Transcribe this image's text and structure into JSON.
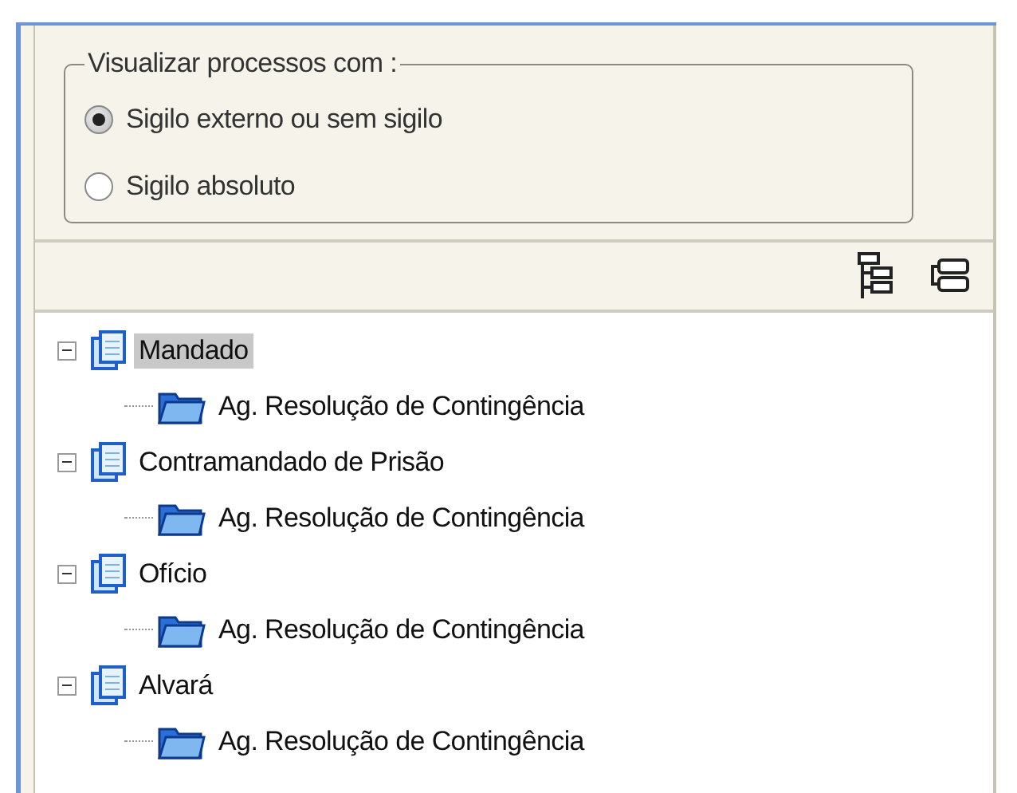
{
  "filter_group": {
    "title": "Visualizar processos com :",
    "options": [
      {
        "label": "Sigilo externo ou sem sigilo",
        "selected": true
      },
      {
        "label": "Sigilo absoluto",
        "selected": false
      }
    ]
  },
  "tree": {
    "items": [
      {
        "label": "Mandado",
        "kind": "document",
        "expanded": true,
        "selected": true,
        "children": [
          {
            "label": "Ag. Resolução de Contingência",
            "kind": "folder",
            "selected": false
          }
        ]
      },
      {
        "label": "Contramandado de Prisão",
        "kind": "document",
        "expanded": true,
        "selected": false,
        "children": [
          {
            "label": "Ag. Resolução de Contingência",
            "kind": "folder",
            "selected": false
          }
        ]
      },
      {
        "label": "Ofício",
        "kind": "document",
        "expanded": true,
        "selected": false,
        "children": [
          {
            "label": "Ag. Resolução de Contingência",
            "kind": "folder",
            "selected": false
          }
        ]
      },
      {
        "label": "Alvará",
        "kind": "document",
        "expanded": true,
        "selected": false,
        "children": [
          {
            "label": "Ag. Resolução de Contingência",
            "kind": "folder",
            "selected": false
          }
        ]
      }
    ]
  }
}
